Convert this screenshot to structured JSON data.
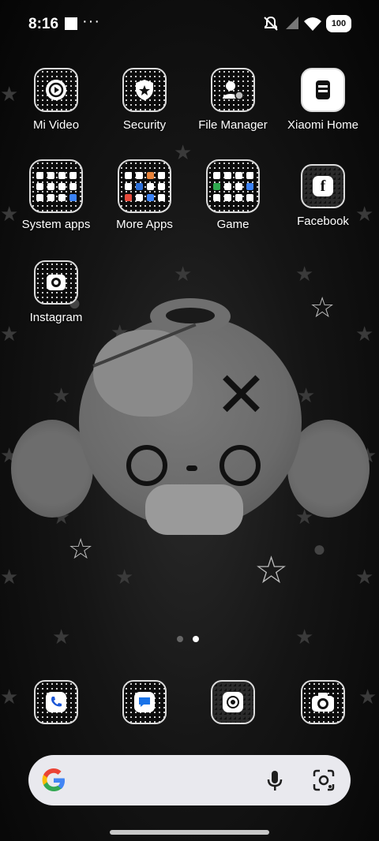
{
  "status_bar": {
    "time": "8:16",
    "battery": "100",
    "icons": [
      "notification-square-icon",
      "more-dots-icon",
      "mute-icon",
      "signal-icon",
      "wifi-icon",
      "battery-icon"
    ]
  },
  "apps": [
    {
      "label": "Mi Video",
      "icon": "play-icon"
    },
    {
      "label": "Security",
      "icon": "shield-icon"
    },
    {
      "label": "File Manager",
      "icon": "folder-user-icon"
    },
    {
      "label": "Xiaomi Home",
      "icon": "home-device-icon"
    },
    {
      "label": "System apps",
      "icon": "folder-icon"
    },
    {
      "label": "More Apps",
      "icon": "folder-icon"
    },
    {
      "label": "Game",
      "icon": "folder-icon"
    },
    {
      "label": "Facebook",
      "icon": "facebook-icon"
    },
    {
      "label": "Instagram",
      "icon": "camera-icon"
    }
  ],
  "dock": [
    {
      "name": "phone",
      "icon": "phone-icon"
    },
    {
      "name": "messages",
      "icon": "message-icon"
    },
    {
      "name": "chrome",
      "icon": "chrome-icon"
    },
    {
      "name": "camera",
      "icon": "camera-icon"
    }
  ],
  "pager": {
    "pages": 2,
    "current": 2
  },
  "search": {
    "logo": "google-g-icon",
    "voice": "mic-icon",
    "lens": "lens-icon"
  },
  "colors": {
    "background": "#0a0a0a",
    "search_bar": "#e9e9ee",
    "icon_border": "#dcdcdc"
  }
}
